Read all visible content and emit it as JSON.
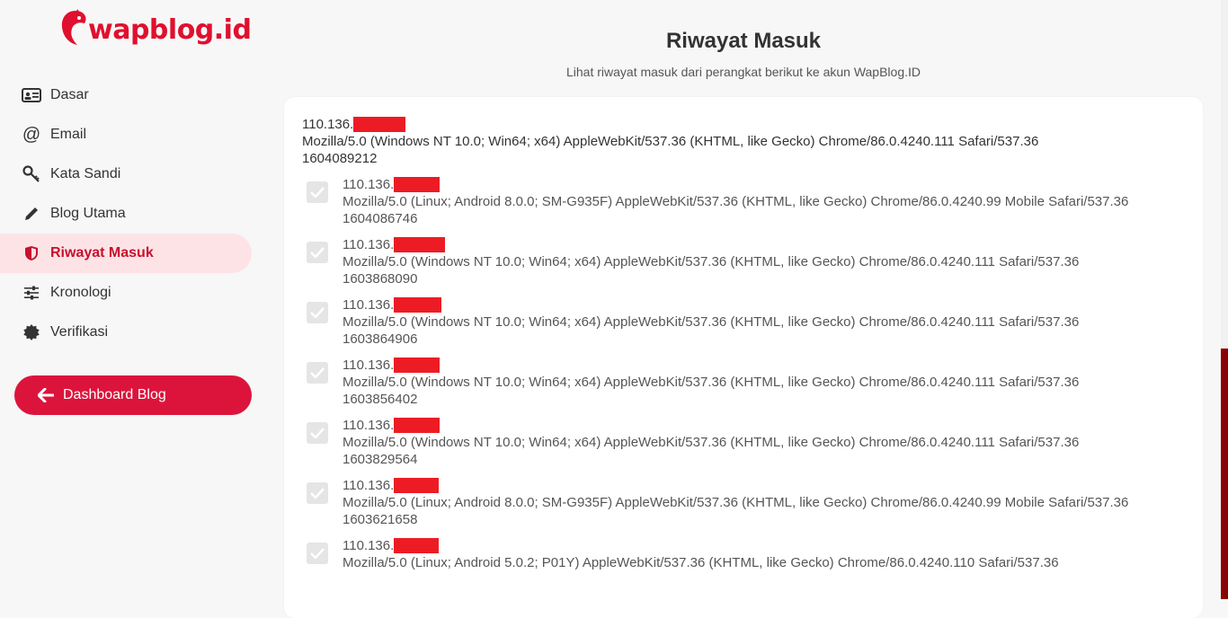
{
  "brand": {
    "logo_text": "wapblog.id"
  },
  "sidebar": {
    "items": [
      {
        "label": "Dasar",
        "icon": "id-card-icon"
      },
      {
        "label": "Email",
        "icon": "at-icon"
      },
      {
        "label": "Kata Sandi",
        "icon": "key-icon"
      },
      {
        "label": "Blog Utama",
        "icon": "pencil-icon"
      },
      {
        "label": "Riwayat Masuk",
        "icon": "shield-icon",
        "active": true
      },
      {
        "label": "Kronologi",
        "icon": "sliders-icon"
      },
      {
        "label": "Verifikasi",
        "icon": "badge-icon"
      }
    ],
    "dashboard_button": "Dashboard Blog"
  },
  "main": {
    "title": "Riwayat Masuk",
    "subtitle": "Lihat riwayat masuk dari perangkat berikut ke akun WapBlog.ID",
    "current": {
      "ip": "110.136.",
      "agent": "Mozilla/5.0 (Windows NT 10.0; Win64; x64) AppleWebKit/537.36 (KHTML, like Gecko) Chrome/86.0.4240.111 Safari/537.36",
      "time": "1604089212"
    },
    "entries": [
      {
        "ip": "110.136.",
        "agent": "Mozilla/5.0 (Linux; Android 8.0.0; SM-G935F) AppleWebKit/537.36 (KHTML, like Gecko) Chrome/86.0.4240.99 Mobile Safari/537.36",
        "time": "1604086746"
      },
      {
        "ip": "110.136.",
        "agent": "Mozilla/5.0 (Windows NT 10.0; Win64; x64) AppleWebKit/537.36 (KHTML, like Gecko) Chrome/86.0.4240.111 Safari/537.36",
        "time": "1603868090"
      },
      {
        "ip": "110.136.",
        "agent": "Mozilla/5.0 (Windows NT 10.0; Win64; x64) AppleWebKit/537.36 (KHTML, like Gecko) Chrome/86.0.4240.111 Safari/537.36",
        "time": "1603864906"
      },
      {
        "ip": "110.136.",
        "agent": "Mozilla/5.0 (Windows NT 10.0; Win64; x64) AppleWebKit/537.36 (KHTML, like Gecko) Chrome/86.0.4240.111 Safari/537.36",
        "time": "1603856402"
      },
      {
        "ip": "110.136.",
        "agent": "Mozilla/5.0 (Windows NT 10.0; Win64; x64) AppleWebKit/537.36 (KHTML, like Gecko) Chrome/86.0.4240.111 Safari/537.36",
        "time": "1603829564"
      },
      {
        "ip": "110.136.",
        "agent": "Mozilla/5.0 (Linux; Android 8.0.0; SM-G935F) AppleWebKit/537.36 (KHTML, like Gecko) Chrome/86.0.4240.99 Mobile Safari/537.36",
        "time": "1603621658"
      },
      {
        "ip": "110.136.",
        "agent": "Mozilla/5.0 (Linux; Android 5.0.2; P01Y) AppleWebKit/537.36 (KHTML, like Gecko) Chrome/86.0.4240.110 Safari/537.36",
        "time": ""
      }
    ]
  },
  "colors": {
    "accent": "#dc143c",
    "active_bg": "#fde3e6",
    "redaction": "#ed1c24"
  }
}
